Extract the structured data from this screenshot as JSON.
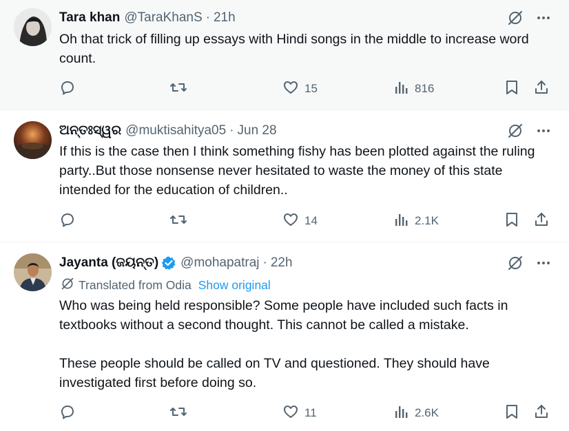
{
  "tweets": [
    {
      "name": "Tara khan",
      "handle": "@TaraKhanS",
      "dot": "·",
      "time": "21h",
      "text": "Oh that trick of filling up essays with Hindi songs in the middle to increase word count.",
      "likes": "15",
      "views": "816"
    },
    {
      "name": "ଅନ୍ତଃସ୍ୱର",
      "handle": "@muktisahitya05",
      "dot": "·",
      "time": "Jun 28",
      "text": "If this is the case then I think something fishy has been plotted against the ruling party..But those nonsense never hesitated to waste the money of this state intended for the education of children..",
      "likes": "14",
      "views": "2.1K"
    },
    {
      "name": "Jayanta (ଜୟନ୍ତ)",
      "handle": "@mohapatraj",
      "dot": "·",
      "time": "22h",
      "translated_label": "Translated from Odia",
      "show_original": "Show original",
      "paragraph1": "Who was being held responsible? Some people have included such facts in textbooks without a second thought. This cannot be called a mistake.",
      "paragraph2": "These people should be called on TV and questioned. They should have investigated first before doing so.",
      "likes": "11",
      "views": "2.6K"
    }
  ],
  "colors": {
    "accent": "#1d9bf0",
    "secondary_text": "#536471",
    "primary_text": "#0f1419",
    "highlight_bg": "#f7f9f9"
  },
  "icons": [
    "grok-icon",
    "more-icon",
    "reply-icon",
    "retweet-icon",
    "like-icon",
    "views-icon",
    "bookmark-icon",
    "share-icon",
    "verified-icon",
    "translate-icon"
  ]
}
